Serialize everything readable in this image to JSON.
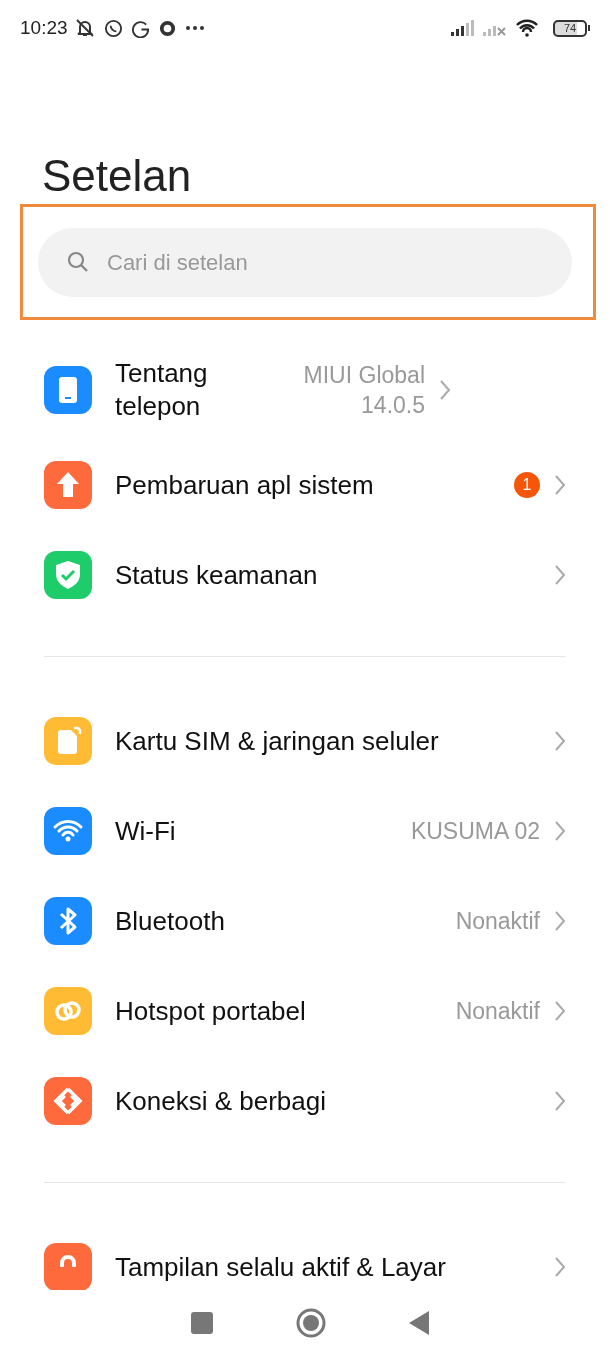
{
  "status_bar": {
    "time": "10:23",
    "battery": "74"
  },
  "title": "Setelan",
  "search": {
    "placeholder": "Cari di setelan"
  },
  "sections": [
    {
      "items": [
        {
          "title": "Tentang telepon",
          "value": "MIUI Global 14.0.5"
        },
        {
          "title": "Pembaruan apl sistem",
          "badge": "1"
        },
        {
          "title": "Status keamanan"
        }
      ]
    },
    {
      "items": [
        {
          "title": "Kartu SIM & jaringan seluler"
        },
        {
          "title": "Wi-Fi",
          "value": "KUSUMA 02"
        },
        {
          "title": "Bluetooth",
          "value": "Nonaktif"
        },
        {
          "title": "Hotspot portabel",
          "value": "Nonaktif"
        },
        {
          "title": "Koneksi & berbagi"
        }
      ]
    },
    {
      "items": [
        {
          "title": "Tampilan selalu aktif & Layar"
        }
      ]
    }
  ]
}
